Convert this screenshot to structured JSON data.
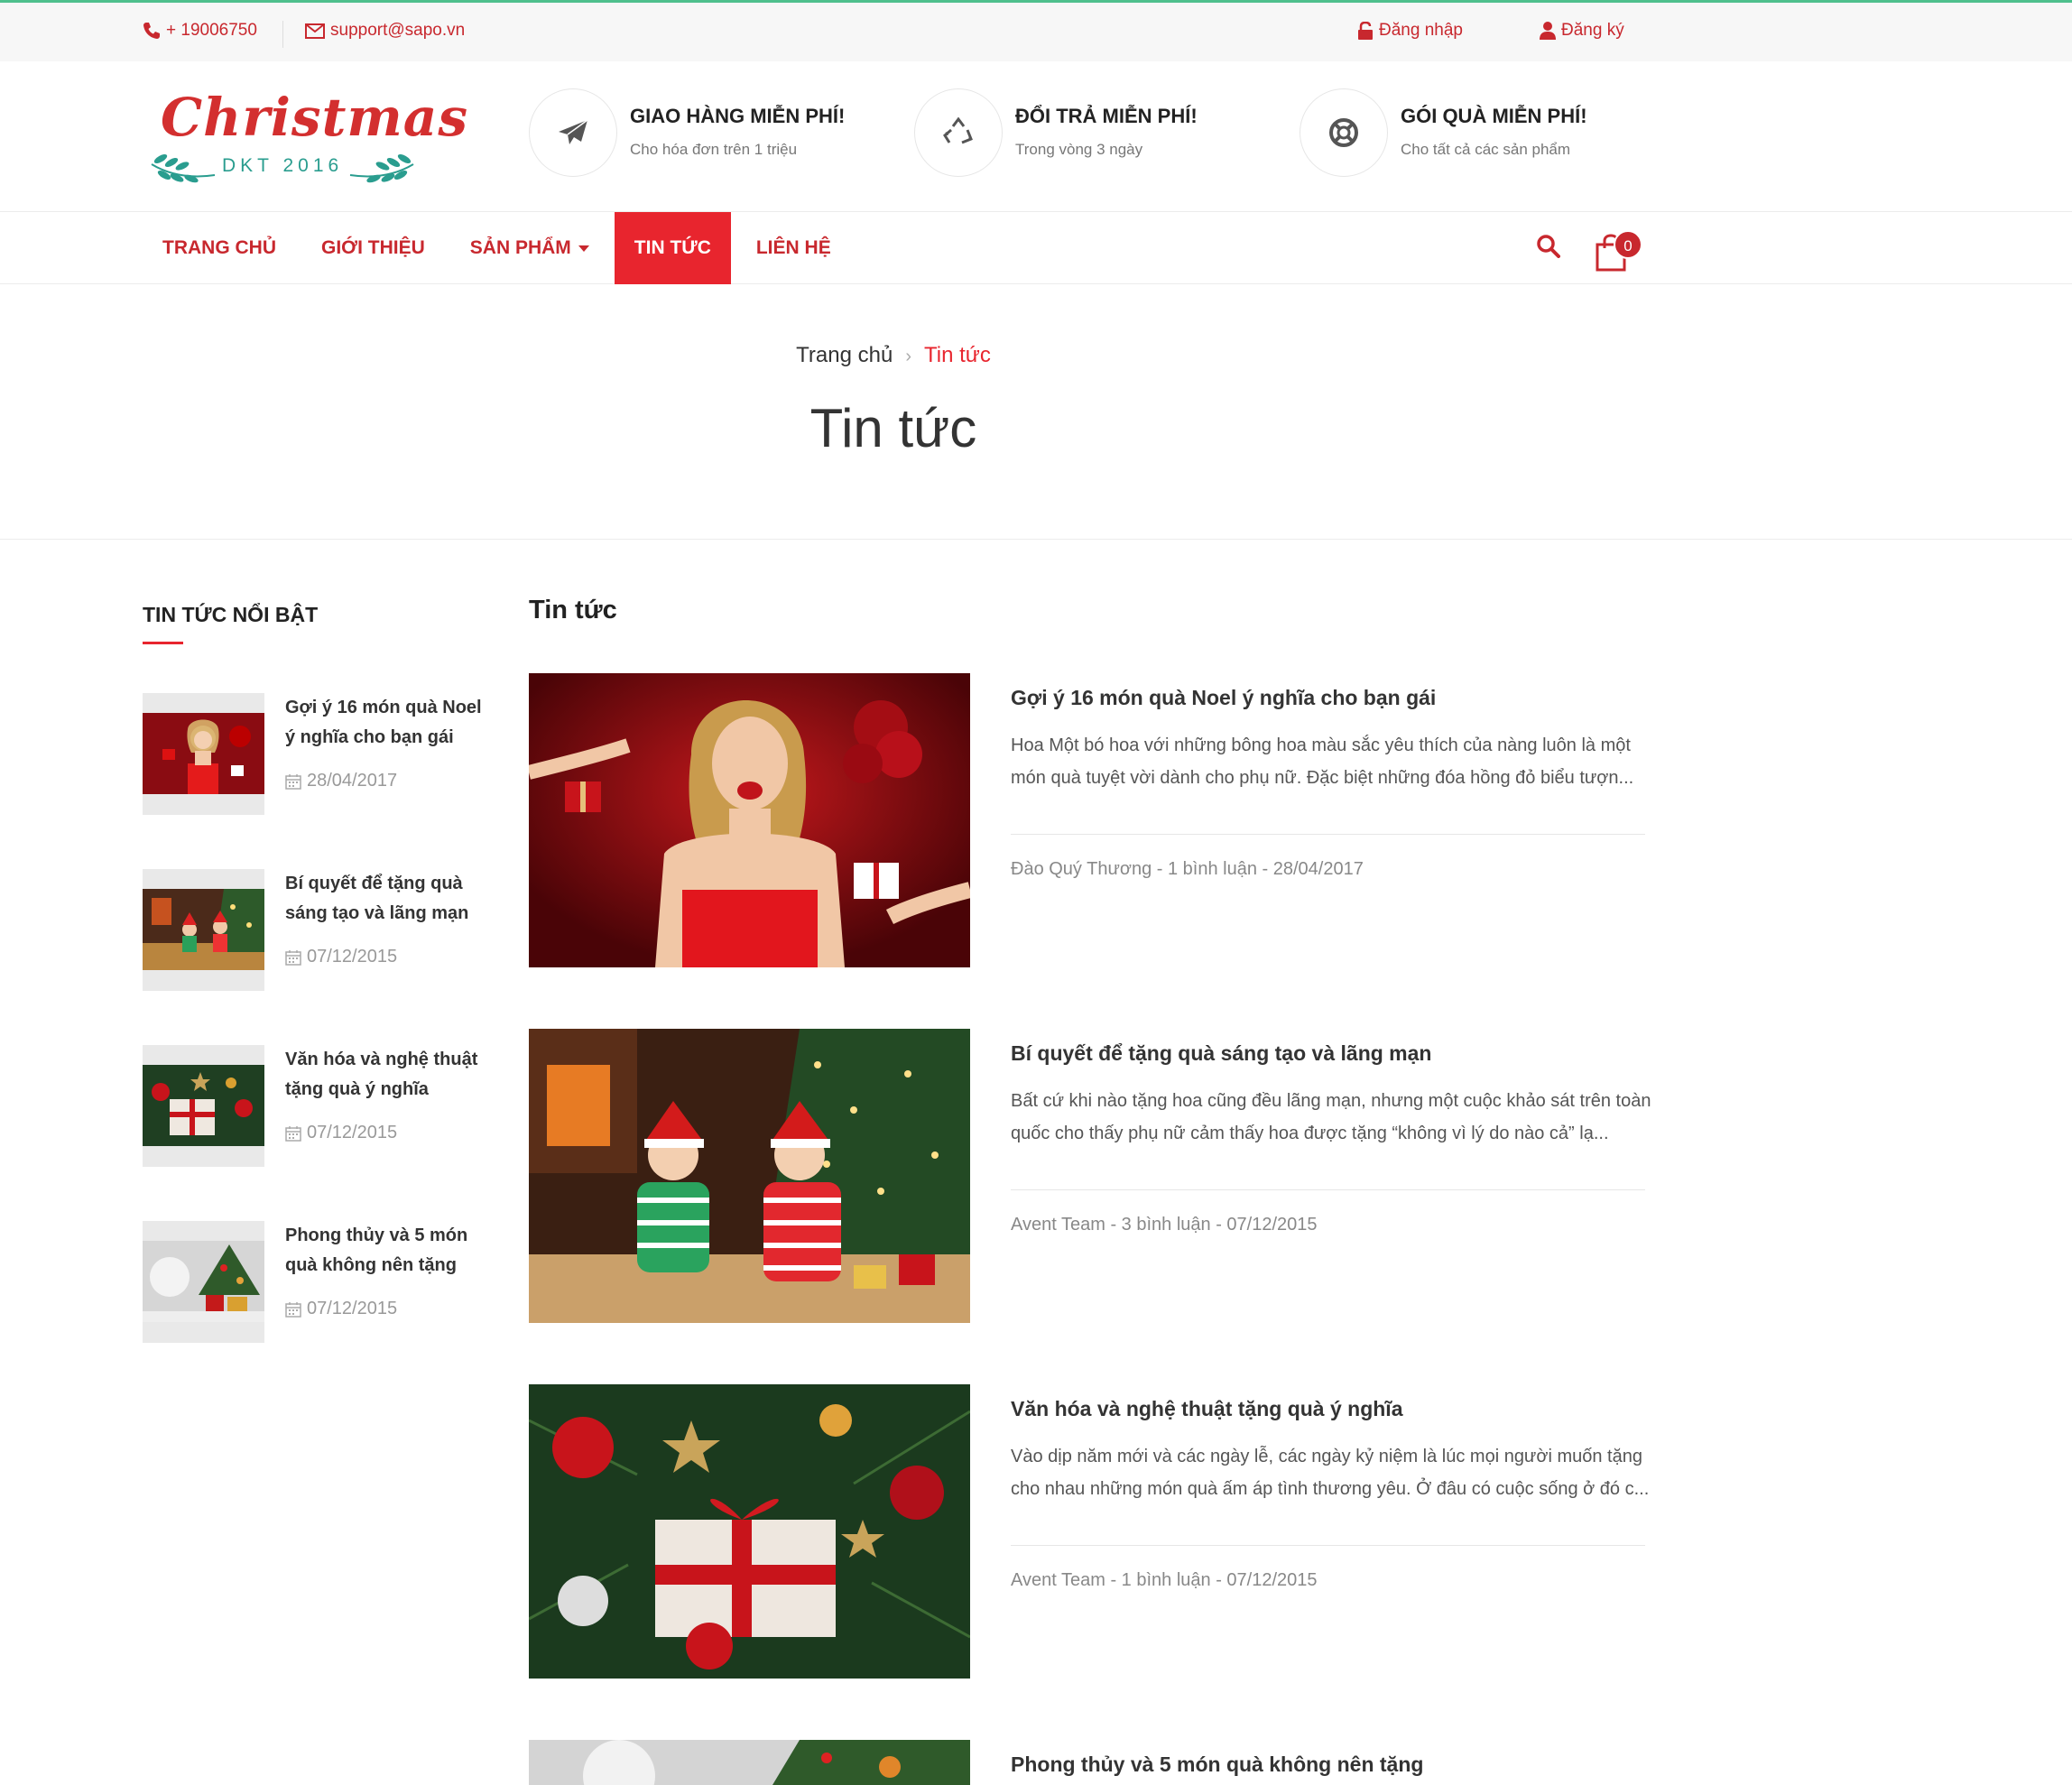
{
  "topbar": {
    "phone": "+ 19006750",
    "email": "support@sapo.vn",
    "login": "Đăng nhập",
    "register": "Đăng ký"
  },
  "logo": {
    "title": "Christmas",
    "subtitle": "DKT 2016"
  },
  "features": [
    {
      "title": "GIAO HÀNG MIỄN PHÍ!",
      "subtitle": "Cho hóa đơn trên 1 triệu",
      "icon": "paper-plane-icon"
    },
    {
      "title": "ĐỔI TRẢ MIỄN PHÍ!",
      "subtitle": "Trong vòng 3 ngày",
      "icon": "recycle-icon"
    },
    {
      "title": "GÓI QUÀ MIỄN PHÍ!",
      "subtitle": "Cho tất cả các sản phẩm",
      "icon": "lifebuoy-icon"
    }
  ],
  "nav": {
    "items": [
      {
        "label": "TRANG CHỦ"
      },
      {
        "label": "GIỚI THIỆU"
      },
      {
        "label": "SẢN PHẨM"
      },
      {
        "label": "TIN TỨC"
      },
      {
        "label": "LIÊN HỆ"
      }
    ],
    "cart_count": "0"
  },
  "breadcrumb": {
    "home": "Trang chủ",
    "current": "Tin tức"
  },
  "page_title": "Tin tức",
  "sidebar": {
    "title": "TIN TỨC NỔI BẬT",
    "items": [
      {
        "title": "Gợi ý 16 món quà Noel ý nghĩa cho bạn gái",
        "date": "28/04/2017"
      },
      {
        "title": "Bí quyết để tặng quà sáng tạo và lãng mạn",
        "date": "07/12/2015"
      },
      {
        "title": "Văn hóa và nghệ thuật tặng quà ý nghĩa",
        "date": "07/12/2015"
      },
      {
        "title": "Phong thủy và 5 món quà không nên tặng",
        "date": "07/12/2015"
      }
    ]
  },
  "main": {
    "title": "Tin tức",
    "posts": [
      {
        "title": "Gợi ý 16 món quà Noel ý nghĩa cho bạn gái",
        "excerpt": "Hoa Một bó hoa với những bông hoa màu sắc yêu thích của nàng luôn là một món quà tuyệt vời dành cho phụ nữ. Đặc biệt những đóa hồng đỏ biểu tượn...",
        "meta": "Đào Quý Thương - 1 bình luận - 28/04/2017"
      },
      {
        "title": "Bí quyết để tặng quà sáng tạo và lãng mạn",
        "excerpt": "Bất cứ khi nào tặng hoa cũng đều lãng mạn, nhưng một cuộc khảo sát trên toàn quốc cho thấy phụ nữ cảm thấy hoa được tặng “không vì lý do nào cả” lạ...",
        "meta": "Avent Team - 3 bình luận - 07/12/2015"
      },
      {
        "title": "Văn hóa và nghệ thuật tặng quà ý nghĩa",
        "excerpt": "Vào dịp năm mới và các ngày lễ, các ngày kỷ niệm là lúc mọi người muốn tặng cho nhau những món quà ấm áp tình thương yêu. Ở đâu có cuộc sống ở đó c...",
        "meta": "Avent Team - 1 bình luận - 07/12/2015"
      },
      {
        "title": "Phong thủy và 5 món quà không nên tặng",
        "excerpt": "",
        "meta": ""
      }
    ]
  },
  "colors": {
    "accent": "#e8252e",
    "brand_red": "#c8282e",
    "topbar_line": "#4fc08d"
  }
}
